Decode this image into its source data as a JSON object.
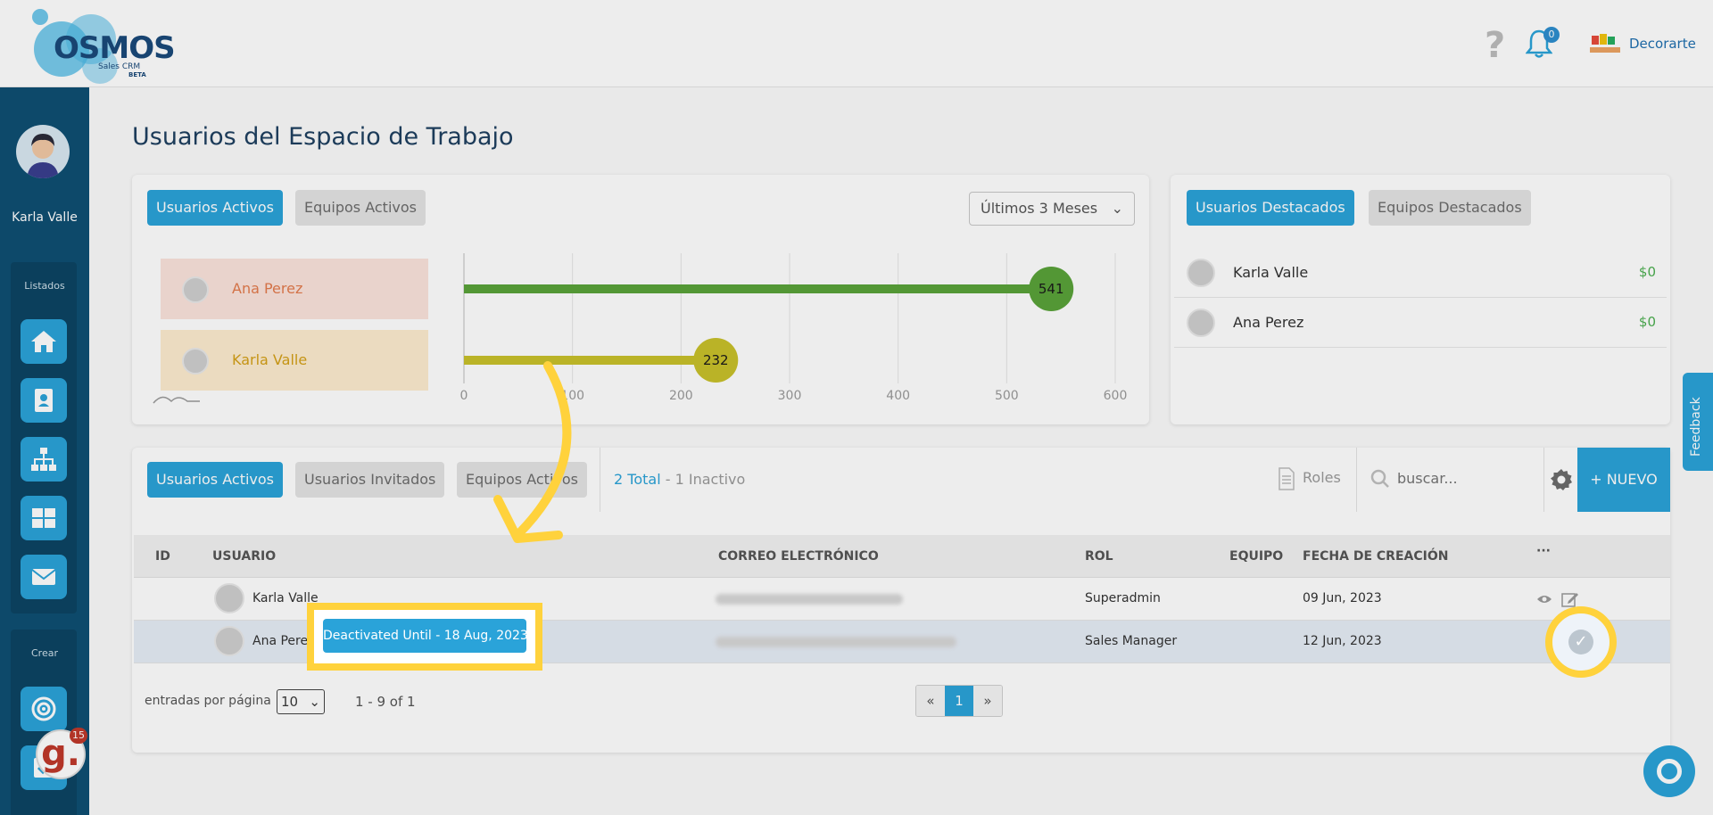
{
  "header": {
    "logo_word": "OSMOS",
    "logo_sub": "Sales CRM",
    "logo_beta": "BETA",
    "notification_count": "0",
    "company_name": "Decorarte"
  },
  "sidebar": {
    "user_name": "Karla Valle",
    "section_listados": "Listados",
    "section_crear": "Crear",
    "grammarly_count": "15"
  },
  "page": {
    "title": "Usuarios del Espacio de Trabajo"
  },
  "top_card": {
    "tabs": [
      "Usuarios Activos",
      "Equipos Activos"
    ],
    "period": "Últimos 3 Meses",
    "ranking": [
      {
        "name": "Ana Perez",
        "color": "#e37b4d",
        "bg": "#fbe4dc"
      },
      {
        "name": "Karla Valle",
        "color": "#d4a017",
        "bg": "#fdeccf"
      }
    ]
  },
  "chart_data": {
    "type": "bar",
    "orientation": "horizontal",
    "categories": [
      "Ana Perez",
      "Karla Valle"
    ],
    "values": [
      541,
      232
    ],
    "colors": [
      "#5aa33a",
      "#c9c12a"
    ],
    "xlim": [
      0,
      600
    ],
    "xticks": [
      "0",
      "100",
      "200",
      "300",
      "400",
      "500",
      "600"
    ],
    "grid": true
  },
  "dest_card": {
    "tabs": [
      "Usuarios Destacados",
      "Equipos Destacados"
    ],
    "rows": [
      {
        "name": "Karla Valle",
        "amount": "$0"
      },
      {
        "name": "Ana Perez",
        "amount": "$0"
      }
    ]
  },
  "table_card": {
    "tabs": [
      "Usuarios Activos",
      "Usuarios Invitados",
      "Equipos Activos"
    ],
    "total": "2 Total",
    "inactive": " - 1 Inactivo",
    "roles_label": "Roles",
    "search_placeholder": "buscar...",
    "new_button": "+ NUEVO",
    "columns": [
      "ID",
      "USUARIO",
      "CORREO ELECTRÓNICO",
      "ROL",
      "EQUIPO",
      "FECHA DE CREACIÓN",
      "···"
    ],
    "rows": [
      {
        "user": "Karla Valle",
        "role": "Superadmin",
        "team": "",
        "created": "09 Jun, 2023"
      },
      {
        "user": "Ana Perez",
        "role": "Sales Manager",
        "team": "",
        "created": "12 Jun, 2023"
      }
    ],
    "per_page_label": "entradas por página",
    "per_page_value": "10",
    "range": "1 - 9 of 1",
    "pager": [
      "«",
      "1",
      "»"
    ]
  },
  "tooltip": "Deactivated Until - 18 Aug, 2023",
  "feedback_label": "Feedback"
}
